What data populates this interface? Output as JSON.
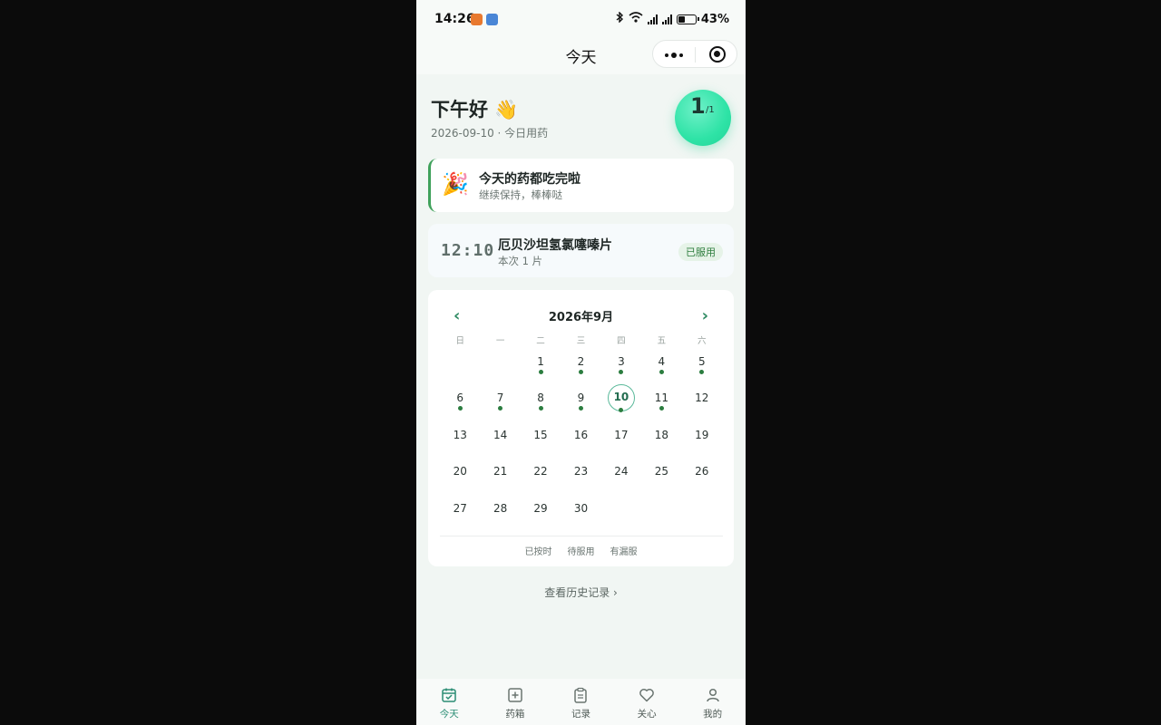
{
  "status_bar": {
    "time": "14:26",
    "battery_text": "43%",
    "battery_level": 0.43,
    "icons": [
      "app-notification-orange-icon",
      "app-notification-blue-icon",
      "bluetooth-icon",
      "wifi-icon",
      "5g-signal-icon",
      "5g-signal-icon",
      "battery-icon"
    ]
  },
  "nav": {
    "title": "今天",
    "more_icon": "more-dots-icon",
    "close_icon": "target-close-icon"
  },
  "header": {
    "greeting": "下午好 👋",
    "subtitle": "2026-09-10 · 今日用药",
    "progress_done": "1",
    "progress_total": "/1"
  },
  "done_card": {
    "icon": "🎉",
    "title": "今天的药都吃完啦",
    "subtitle": "继续保持，棒棒哒"
  },
  "med_card": {
    "time": "12:10",
    "name": "厄贝沙坦氢氯噻嗪片",
    "dose": "本次 1 片",
    "status": "已服用"
  },
  "calendar": {
    "prev": "‹",
    "next": "›",
    "title": "2026年9月",
    "weekdays": [
      "日",
      "一",
      "二",
      "三",
      "四",
      "五",
      "六"
    ],
    "leading_blanks": 2,
    "days": [
      {
        "n": "1",
        "dot": true
      },
      {
        "n": "2",
        "dot": true
      },
      {
        "n": "3",
        "dot": true
      },
      {
        "n": "4",
        "dot": true
      },
      {
        "n": "5",
        "dot": true
      },
      {
        "n": "6",
        "dot": true
      },
      {
        "n": "7",
        "dot": true
      },
      {
        "n": "8",
        "dot": true
      },
      {
        "n": "9",
        "dot": true
      },
      {
        "n": "10",
        "dot": true,
        "today": true
      },
      {
        "n": "11",
        "dot": true
      },
      {
        "n": "12",
        "dot": false
      },
      {
        "n": "13",
        "dot": false
      },
      {
        "n": "14",
        "dot": false
      },
      {
        "n": "15",
        "dot": false
      },
      {
        "n": "16",
        "dot": false
      },
      {
        "n": "17",
        "dot": false
      },
      {
        "n": "18",
        "dot": false
      },
      {
        "n": "19",
        "dot": false
      },
      {
        "n": "20",
        "dot": false
      },
      {
        "n": "21",
        "dot": false
      },
      {
        "n": "22",
        "dot": false
      },
      {
        "n": "23",
        "dot": false
      },
      {
        "n": "24",
        "dot": false
      },
      {
        "n": "25",
        "dot": false
      },
      {
        "n": "26",
        "dot": false
      },
      {
        "n": "27",
        "dot": false
      },
      {
        "n": "28",
        "dot": false
      },
      {
        "n": "29",
        "dot": false
      },
      {
        "n": "30",
        "dot": false
      }
    ],
    "legend": [
      "已按时",
      "待服用",
      "有漏服"
    ],
    "dot_color": "#2b7d3f"
  },
  "history_link": "查看历史记录 ›",
  "tabs": [
    {
      "label": "今天",
      "icon": "calendar-check-icon",
      "active": true
    },
    {
      "label": "药箱",
      "icon": "medicine-box-icon",
      "active": false
    },
    {
      "label": "记录",
      "icon": "clipboard-icon",
      "active": false
    },
    {
      "label": "关心",
      "icon": "heart-icon",
      "active": false
    },
    {
      "label": "我的",
      "icon": "user-icon",
      "active": false
    }
  ],
  "colors": {
    "accent": "#2a8d74",
    "progress": "#2ee3a6",
    "taken_badge_bg": "#e6f3e8",
    "taken_badge_text": "#2e7d3e"
  }
}
